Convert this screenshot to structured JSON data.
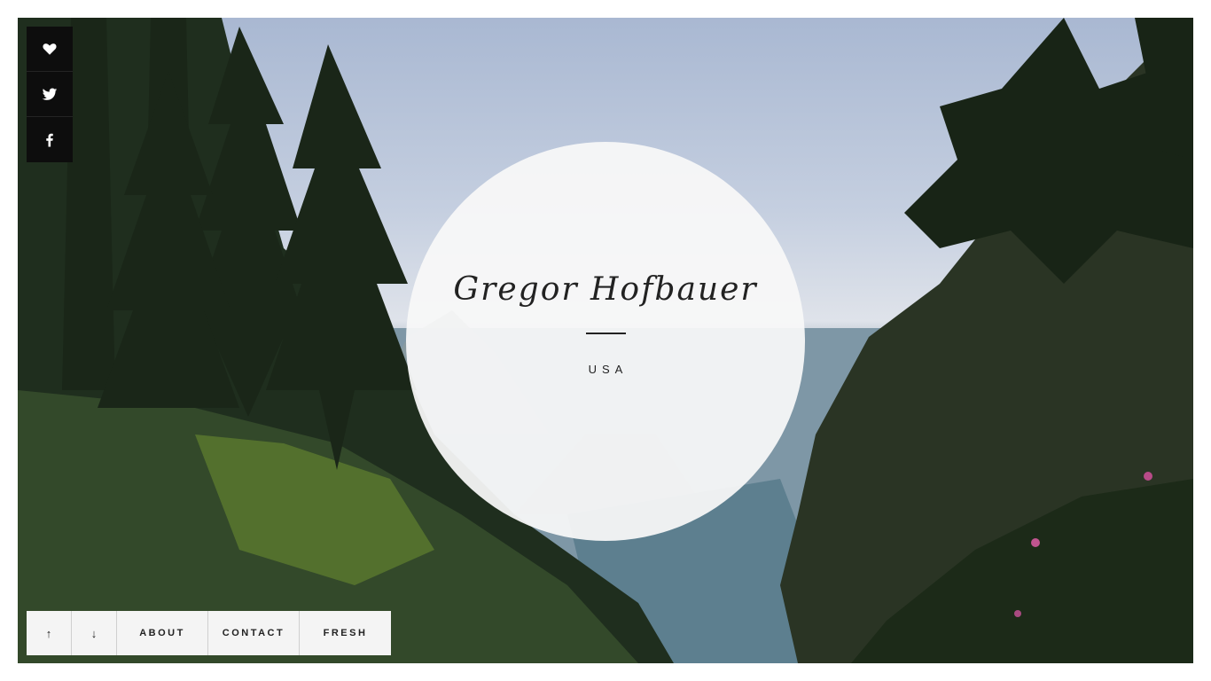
{
  "social": {
    "items": [
      {
        "icon": "heart-icon",
        "label": "Like"
      },
      {
        "icon": "twitter-icon",
        "label": "Twitter"
      },
      {
        "icon": "facebook-icon",
        "label": "Facebook"
      }
    ]
  },
  "profile": {
    "name": "Gregor Hofbauer",
    "location": "USA"
  },
  "nav": {
    "up": "↑",
    "down": "↓",
    "about": "ABOUT",
    "contact": "CONTACT",
    "fresh": "FRESH"
  },
  "colors": {
    "button_dark": "#0d0d0d",
    "nav_bg": "#f4f4f4",
    "text": "#222222"
  }
}
